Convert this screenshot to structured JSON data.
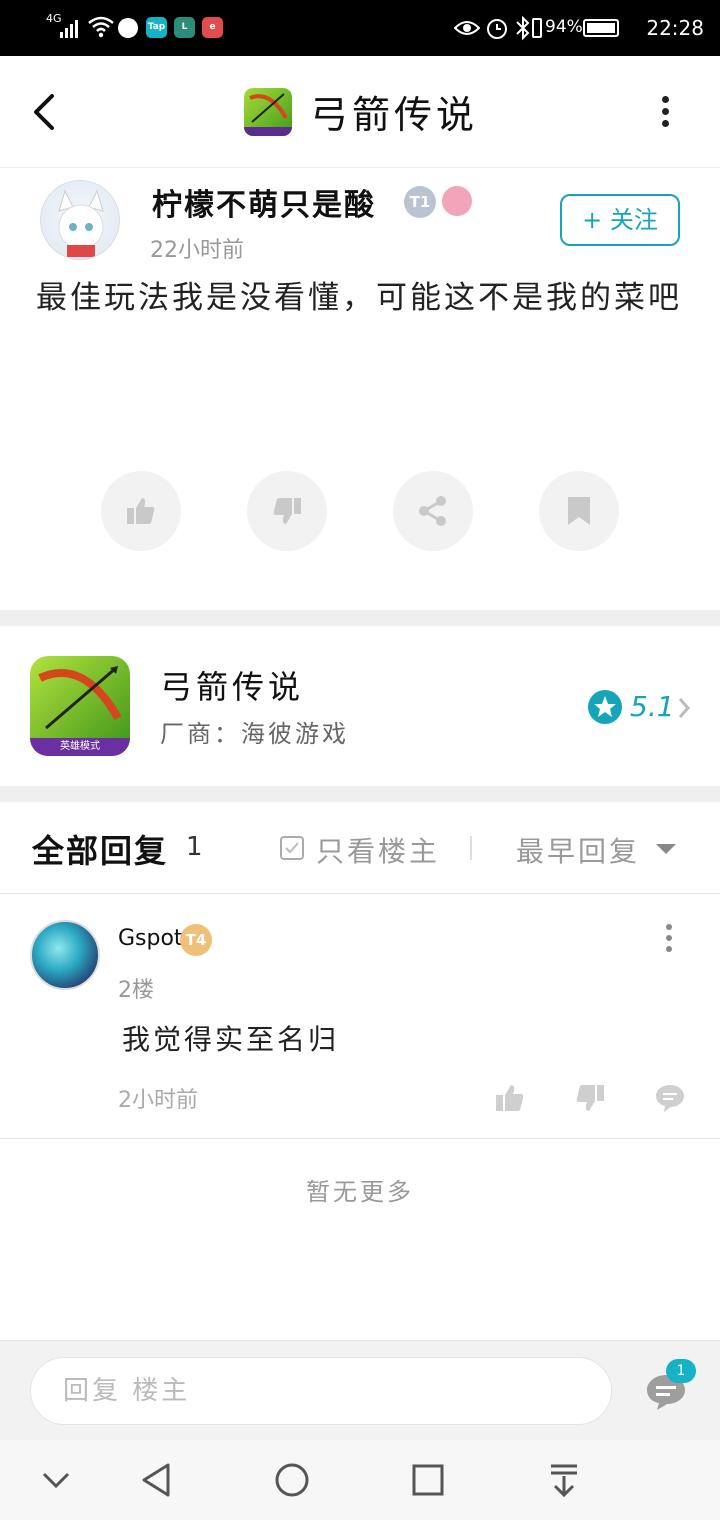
{
  "status_bar": {
    "network": "4G",
    "battery_text": "94%",
    "time": "22:28",
    "app_icons": [
      "Tap",
      "L",
      "e"
    ]
  },
  "header": {
    "title": "弓箭传说",
    "icon_badge": "英雄模式"
  },
  "post": {
    "author_name": "柠檬不萌只是酸",
    "author_level": "T1",
    "time": "22小时前",
    "follow_label": "+ 关注",
    "body": "最佳玩法我是没看懂，可能这不是我的菜吧"
  },
  "game_card": {
    "name": "弓箭传说",
    "vendor": "厂商：海彼游戏",
    "rating": "5.1",
    "icon_badge": "英雄模式"
  },
  "replies_header": {
    "title": "全部回复",
    "count": "1",
    "op_only_label": "只看楼主",
    "sort_label": "最早回复"
  },
  "replies": [
    {
      "user": "Gspot",
      "level": "T4",
      "floor": "2楼",
      "text": "我觉得实至名归",
      "time": "2小时前"
    }
  ],
  "no_more_text": "暂无更多",
  "bottom_bar": {
    "input_placeholder": "回复 楼主",
    "comment_count": "1"
  },
  "colors": {
    "accent": "#16a4b8",
    "gray_bg": "#efefef"
  }
}
